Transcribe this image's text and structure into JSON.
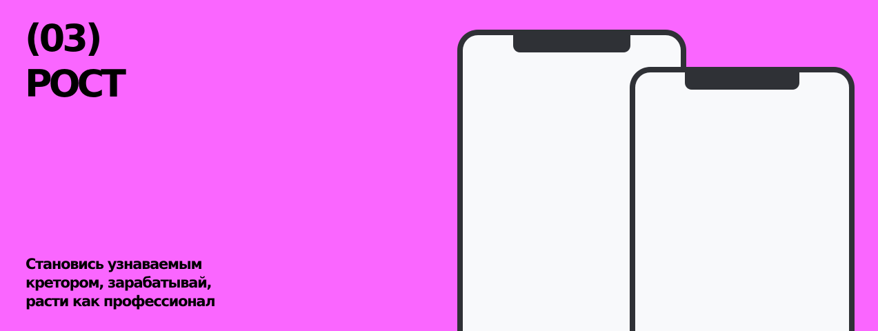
{
  "colors": {
    "background": "#fa66ff",
    "text": "#000000",
    "phone_frame": "#2f3136",
    "phone_screen": "#f8f9fb"
  },
  "step": {
    "number": "(03)",
    "title": "РОСТ",
    "description_lines": [
      "Становись узнаваемым",
      "кретором, зарабатывай,",
      "расти как профессионал"
    ]
  },
  "icons": {
    "phone_back": "smartphone-frame-icon",
    "phone_front": "smartphone-frame-icon"
  }
}
